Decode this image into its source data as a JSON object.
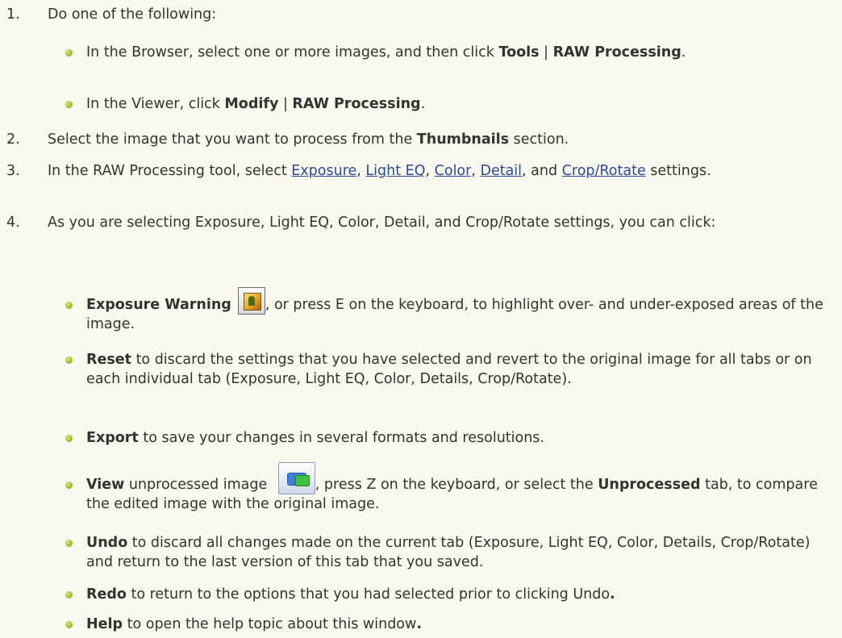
{
  "steps": [
    {
      "num": "1.",
      "text": "Do one of the following:"
    },
    {
      "num": "2.",
      "pre": "Select the image that you want to process from the ",
      "bold": "Thumbnails",
      "post": " section."
    },
    {
      "num": "3.",
      "pre": "In the RAW Processing tool, select ",
      "link1": "Exposure",
      "sep1": ", ",
      "link2": "Light EQ",
      "sep2": ", ",
      "link3": "Color",
      "sep3": ", ",
      "link4": "Detail",
      "sep4": ", and ",
      "link5": "Crop/Rotate",
      "post": " settings."
    },
    {
      "num": "4.",
      "text": "As you are selecting Exposure, Light EQ, Color, Detail, and Crop/Rotate settings, you can click:"
    }
  ],
  "step1_bullets": [
    {
      "pre": "In the Browser, select one or more images, and then click ",
      "b1": "Tools",
      "mid": " | ",
      "b2": "RAW Processing",
      "post": "."
    },
    {
      "pre": "In the Viewer, click ",
      "b1": "Modify",
      "mid": " | ",
      "b2": "RAW Processing",
      "post": "."
    }
  ],
  "step4_bullets": [
    {
      "bold": "Exposure Warning",
      "icon": "exposure-warning-icon",
      "post": ", or press E on the keyboard, to highlight over- and under-exposed areas of the image."
    },
    {
      "bold": "Reset",
      "post": " to discard the settings that you have selected and revert to the original image for all tabs or on each individual tab (Exposure, Light EQ, Color, Details, Crop/Rotate)."
    },
    {
      "bold": "Export",
      "post": " to save your changes in several formats and resolutions."
    },
    {
      "bold": "View",
      "mid": " unprocessed image ",
      "icon": "view-unprocessed-icon",
      "mid2": ", press Z on the keyboard, or select the ",
      "bold2": "Unprocessed",
      "post": " tab, to compare the edited image with the original image."
    },
    {
      "bold": "Undo",
      "post": " to discard all changes made on the current tab (Exposure, Light EQ, Color, Details, Crop/Rotate) and return to the last version of this tab that you saved."
    },
    {
      "bold": "Redo",
      "post": " to return to the options that you had selected prior to clicking Undo",
      "bold_end": "."
    },
    {
      "bold": "Help",
      "post": " to open the help topic about this window",
      "bold_end": "."
    }
  ],
  "colors": {
    "background": "#f9f9ee",
    "text": "#333333",
    "link": "#2a4aa0",
    "bullet": "#a8c030"
  }
}
